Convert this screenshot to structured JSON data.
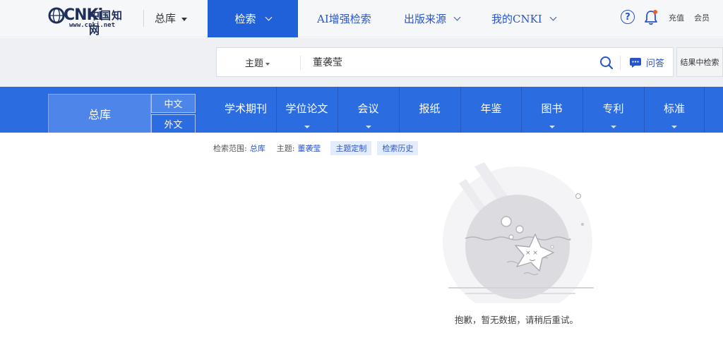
{
  "header": {
    "logo": {
      "brand": "CNKi",
      "cn_name": "中国知网",
      "url": "www.cnki.net"
    },
    "database_select": "总库",
    "nav": [
      {
        "label": "检索",
        "active": true
      },
      {
        "label": "AI增强检索"
      },
      {
        "label": "出版来源"
      },
      {
        "label": "我的CNKI"
      }
    ],
    "help_icon": "?",
    "links": {
      "recharge": "充值",
      "member": "会员"
    }
  },
  "search": {
    "field": "主题",
    "query": "董袭莹",
    "qa_label": "问答",
    "result_search_label": "结果中检索"
  },
  "databases": {
    "total": "总库",
    "languages": [
      "中文",
      "外文"
    ],
    "categories": [
      {
        "label": "学术期刊",
        "has_dropdown": false
      },
      {
        "label": "学位论文",
        "has_dropdown": true
      },
      {
        "label": "会议",
        "has_dropdown": true
      },
      {
        "label": "报纸",
        "has_dropdown": false
      },
      {
        "label": "年鉴",
        "has_dropdown": false
      },
      {
        "label": "图书",
        "has_dropdown": true
      },
      {
        "label": "专利",
        "has_dropdown": true
      },
      {
        "label": "标准",
        "has_dropdown": true
      }
    ]
  },
  "scope": {
    "range_label": "检索范围:",
    "range_value": "总库",
    "topic_label": "主题:",
    "topic_value": "董袭莹",
    "custom_topic": "主题定制",
    "history": "检索历史"
  },
  "empty": {
    "message": "抱歉，暂无数据，请稍后重试。"
  },
  "colors": {
    "primary": "#2060d8",
    "bar": "#2b6ce0",
    "link": "#2a55c9",
    "badge": "#f05a28"
  },
  "icons": [
    "globe-logo-icon",
    "caret-down-icon",
    "chevron-down-icon",
    "help-icon",
    "bell-icon",
    "search-icon",
    "chat-icon",
    "empty-starfish-illustration"
  ]
}
